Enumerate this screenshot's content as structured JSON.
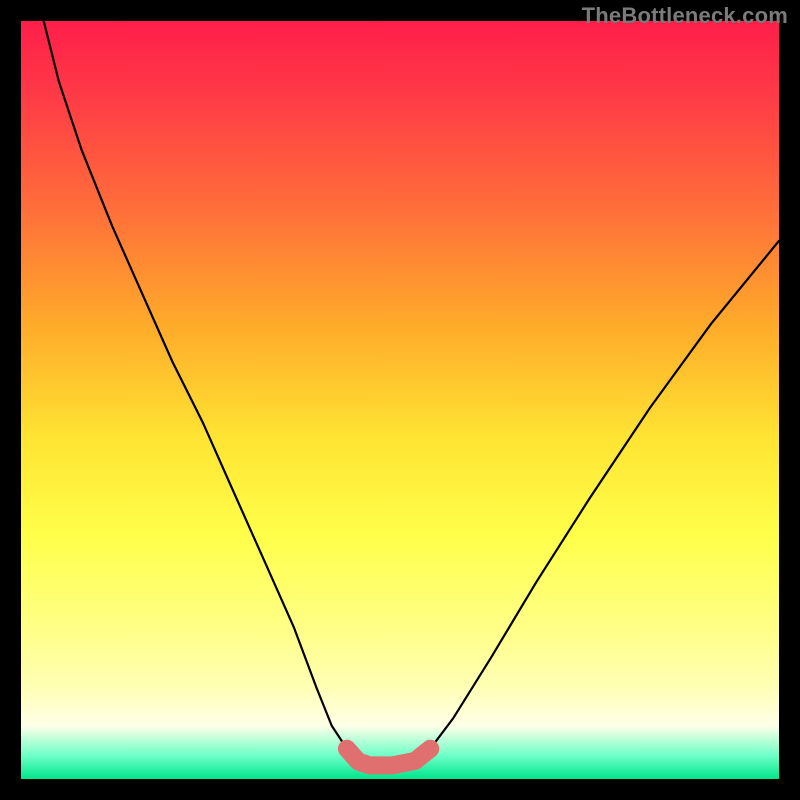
{
  "watermark": "TheBottleneck.com",
  "chart_data": {
    "type": "line",
    "title": "",
    "xlabel": "",
    "ylabel": "",
    "xlim": [
      0,
      100
    ],
    "ylim": [
      0,
      100
    ],
    "series": [
      {
        "name": "curve",
        "x": [
          3,
          5,
          8,
          12,
          16,
          20,
          24,
          28,
          32,
          36,
          39,
          41,
          43,
          44.5,
          46,
          49,
          52,
          54,
          57,
          62,
          68,
          75,
          83,
          91,
          100
        ],
        "y": [
          100,
          92,
          83,
          73,
          64,
          55,
          47,
          38,
          29,
          20,
          12,
          7,
          4,
          2.3,
          1.8,
          1.8,
          2.4,
          4,
          8,
          16,
          26,
          37,
          49,
          60,
          71
        ]
      }
    ],
    "highlight": {
      "name": "bottom-highlight",
      "color": "#e07070",
      "x": [
        43,
        44.5,
        46,
        49,
        52,
        54
      ],
      "y": [
        4,
        2.3,
        1.8,
        1.8,
        2.4,
        4
      ]
    }
  },
  "colors": {
    "curve": "#000000",
    "highlight": "#e07070",
    "background_frame": "#000000"
  }
}
